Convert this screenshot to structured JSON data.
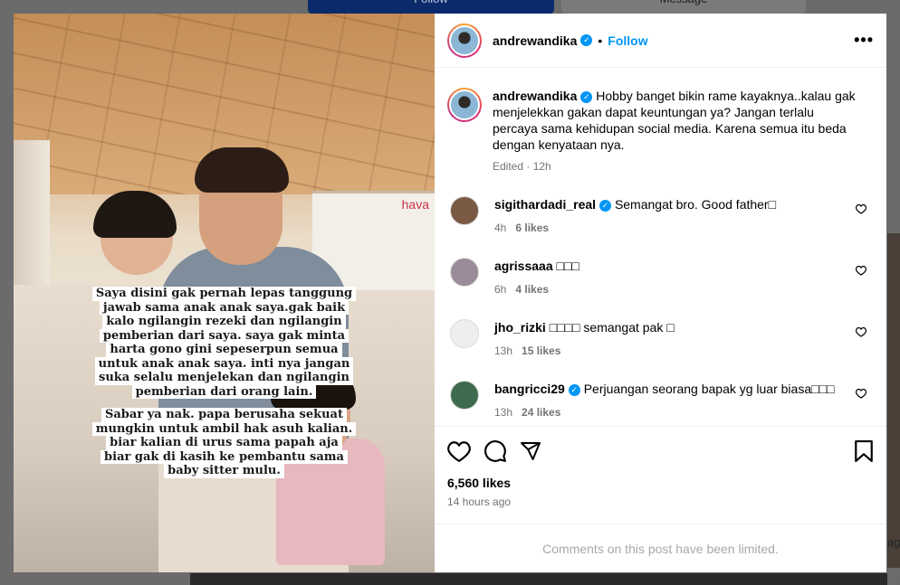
{
  "background": {
    "follow_label": "Follow",
    "message_label": "Message",
    "right_tile_text": "ag"
  },
  "post": {
    "username": "andrewandika",
    "follow_label": "Follow",
    "more_icon": "more-horizontal-icon",
    "caption": "Hobby banget bikin rame kayaknya..kalau gak menjelekkan gakan dapat keuntungan ya? Jangan terlalu percaya sama kehidupan social media. Karena semua itu beda dengan kenyataan nya.",
    "caption_status": "Edited",
    "caption_time": "12h",
    "image_overlay": {
      "block1": [
        "Saya disini gak pernah lepas tanggung",
        "jawab sama anak anak saya.gak baik",
        "kalo ngilangin rezeki dan ngilangin",
        "pemberian dari saya. saya gak minta",
        "harta gono gini sepeserpun semua",
        "untuk anak anak saya. inti nya jangan",
        "suka selalu menjelekan dan ngilangin",
        "pemberian dari orang lain."
      ],
      "block2": [
        "Sabar ya nak. papa berusaha sekuat",
        "mungkin untuk ambil hak asuh kalian.",
        "biar kalian di urus sama papah aja",
        "biar gak di kasih ke pembantu sama",
        "baby sitter mulu."
      ],
      "store_sign": "hava"
    },
    "comments": [
      {
        "username": "sigithardadi_real",
        "verified": true,
        "text": "Semangat bro. Good father□",
        "time": "4h",
        "likes": "6 likes",
        "avatar_color": "#7a5a45"
      },
      {
        "username": "agrissaaa",
        "verified": false,
        "text": "□□□",
        "time": "6h",
        "likes": "4 likes",
        "avatar_color": "#9b8c9a"
      },
      {
        "username": "jho_rizki",
        "verified": false,
        "text": "□□□□ semangat pak □",
        "time": "13h",
        "likes": "15 likes",
        "avatar_color": "#eeeeee"
      },
      {
        "username": "bangricci29",
        "verified": true,
        "text": "Perjuangan seorang bapak yg luar biasa□□□",
        "time": "13h",
        "likes": "24 likes",
        "avatar_color": "#3e6b4e"
      }
    ],
    "likes": "6,560 likes",
    "time_ago": "14 hours ago",
    "comments_limited": "Comments on this post have been limited."
  },
  "colors": {
    "accent": "#0095f6",
    "muted": "#737373"
  }
}
